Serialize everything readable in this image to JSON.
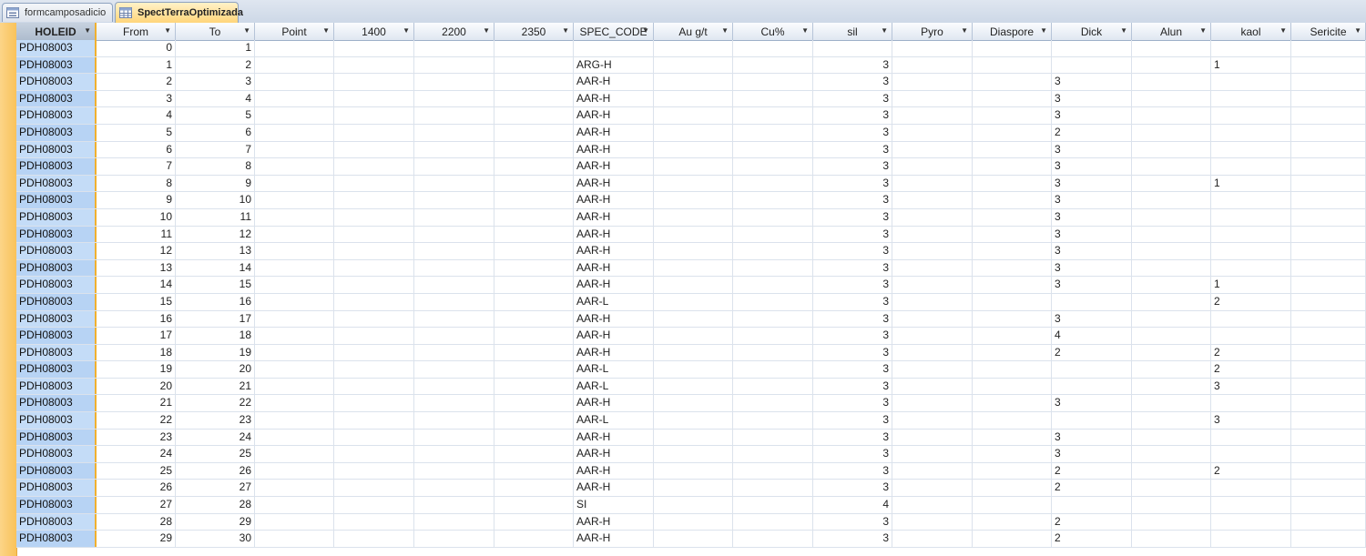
{
  "tabs": [
    {
      "label": "formcamposadicio",
      "icon": "form-icon",
      "active": false
    },
    {
      "label": "SpectTerraOptimizada",
      "icon": "table-icon",
      "active": true
    }
  ],
  "columns": [
    "HOLEID",
    "From",
    "To",
    "Point",
    "1400",
    "2200",
    "2350",
    "SPEC_CODE",
    "Au g/t",
    "Cu%",
    "sil",
    "Pyro",
    "Diaspore",
    "Dick",
    "Alun",
    "kaol",
    "Sericite"
  ],
  "rows": [
    [
      "PDH08003",
      "0",
      "1",
      "",
      "",
      "",
      "",
      "",
      "",
      "",
      "",
      "",
      "",
      "",
      "",
      "",
      ""
    ],
    [
      "PDH08003",
      "1",
      "2",
      "",
      "",
      "",
      "",
      "ARG-H",
      "",
      "",
      "3",
      "",
      "",
      "",
      "",
      "1",
      ""
    ],
    [
      "PDH08003",
      "2",
      "3",
      "",
      "",
      "",
      "",
      "AAR-H",
      "",
      "",
      "3",
      "",
      "",
      "3",
      "",
      "",
      ""
    ],
    [
      "PDH08003",
      "3",
      "4",
      "",
      "",
      "",
      "",
      "AAR-H",
      "",
      "",
      "3",
      "",
      "",
      "3",
      "",
      "",
      ""
    ],
    [
      "PDH08003",
      "4",
      "5",
      "",
      "",
      "",
      "",
      "AAR-H",
      "",
      "",
      "3",
      "",
      "",
      "3",
      "",
      "",
      ""
    ],
    [
      "PDH08003",
      "5",
      "6",
      "",
      "",
      "",
      "",
      "AAR-H",
      "",
      "",
      "3",
      "",
      "",
      "2",
      "",
      "",
      ""
    ],
    [
      "PDH08003",
      "6",
      "7",
      "",
      "",
      "",
      "",
      "AAR-H",
      "",
      "",
      "3",
      "",
      "",
      "3",
      "",
      "",
      ""
    ],
    [
      "PDH08003",
      "7",
      "8",
      "",
      "",
      "",
      "",
      "AAR-H",
      "",
      "",
      "3",
      "",
      "",
      "3",
      "",
      "",
      ""
    ],
    [
      "PDH08003",
      "8",
      "9",
      "",
      "",
      "",
      "",
      "AAR-H",
      "",
      "",
      "3",
      "",
      "",
      "3",
      "",
      "1",
      ""
    ],
    [
      "PDH08003",
      "9",
      "10",
      "",
      "",
      "",
      "",
      "AAR-H",
      "",
      "",
      "3",
      "",
      "",
      "3",
      "",
      "",
      ""
    ],
    [
      "PDH08003",
      "10",
      "11",
      "",
      "",
      "",
      "",
      "AAR-H",
      "",
      "",
      "3",
      "",
      "",
      "3",
      "",
      "",
      ""
    ],
    [
      "PDH08003",
      "11",
      "12",
      "",
      "",
      "",
      "",
      "AAR-H",
      "",
      "",
      "3",
      "",
      "",
      "3",
      "",
      "",
      ""
    ],
    [
      "PDH08003",
      "12",
      "13",
      "",
      "",
      "",
      "",
      "AAR-H",
      "",
      "",
      "3",
      "",
      "",
      "3",
      "",
      "",
      ""
    ],
    [
      "PDH08003",
      "13",
      "14",
      "",
      "",
      "",
      "",
      "AAR-H",
      "",
      "",
      "3",
      "",
      "",
      "3",
      "",
      "",
      ""
    ],
    [
      "PDH08003",
      "14",
      "15",
      "",
      "",
      "",
      "",
      "AAR-H",
      "",
      "",
      "3",
      "",
      "",
      "3",
      "",
      "1",
      ""
    ],
    [
      "PDH08003",
      "15",
      "16",
      "",
      "",
      "",
      "",
      "AAR-L",
      "",
      "",
      "3",
      "",
      "",
      "",
      "",
      "2",
      ""
    ],
    [
      "PDH08003",
      "16",
      "17",
      "",
      "",
      "",
      "",
      "AAR-H",
      "",
      "",
      "3",
      "",
      "",
      "3",
      "",
      "",
      ""
    ],
    [
      "PDH08003",
      "17",
      "18",
      "",
      "",
      "",
      "",
      "AAR-H",
      "",
      "",
      "3",
      "",
      "",
      "4",
      "",
      "",
      ""
    ],
    [
      "PDH08003",
      "18",
      "19",
      "",
      "",
      "",
      "",
      "AAR-H",
      "",
      "",
      "3",
      "",
      "",
      "2",
      "",
      "2",
      ""
    ],
    [
      "PDH08003",
      "19",
      "20",
      "",
      "",
      "",
      "",
      "AAR-L",
      "",
      "",
      "3",
      "",
      "",
      "",
      "",
      "2",
      ""
    ],
    [
      "PDH08003",
      "20",
      "21",
      "",
      "",
      "",
      "",
      "AAR-L",
      "",
      "",
      "3",
      "",
      "",
      "",
      "",
      "3",
      ""
    ],
    [
      "PDH08003",
      "21",
      "22",
      "",
      "",
      "",
      "",
      "AAR-H",
      "",
      "",
      "3",
      "",
      "",
      "3",
      "",
      "",
      ""
    ],
    [
      "PDH08003",
      "22",
      "23",
      "",
      "",
      "",
      "",
      "AAR-L",
      "",
      "",
      "3",
      "",
      "",
      "",
      "",
      "3",
      ""
    ],
    [
      "PDH08003",
      "23",
      "24",
      "",
      "",
      "",
      "",
      "AAR-H",
      "",
      "",
      "3",
      "",
      "",
      "3",
      "",
      "",
      ""
    ],
    [
      "PDH08003",
      "24",
      "25",
      "",
      "",
      "",
      "",
      "AAR-H",
      "",
      "",
      "3",
      "",
      "",
      "3",
      "",
      "",
      ""
    ],
    [
      "PDH08003",
      "25",
      "26",
      "",
      "",
      "",
      "",
      "AAR-H",
      "",
      "",
      "3",
      "",
      "",
      "2",
      "",
      "2",
      ""
    ],
    [
      "PDH08003",
      "26",
      "27",
      "",
      "",
      "",
      "",
      "AAR-H",
      "",
      "",
      "3",
      "",
      "",
      "2",
      "",
      "",
      ""
    ],
    [
      "PDH08003",
      "27",
      "28",
      "",
      "",
      "",
      "",
      "SI",
      "",
      "",
      "4",
      "",
      "",
      "",
      "",
      "",
      ""
    ],
    [
      "PDH08003",
      "28",
      "29",
      "",
      "",
      "",
      "",
      "AAR-H",
      "",
      "",
      "3",
      "",
      "",
      "2",
      "",
      "",
      ""
    ],
    [
      "PDH08003",
      "29",
      "30",
      "",
      "",
      "",
      "",
      "AAR-H",
      "",
      "",
      "3",
      "",
      "",
      "2",
      "",
      "",
      ""
    ]
  ],
  "colors": {
    "active_tab": "#ffd57a",
    "selector": "#f9c25a",
    "key_column": "#c4dcf7"
  }
}
